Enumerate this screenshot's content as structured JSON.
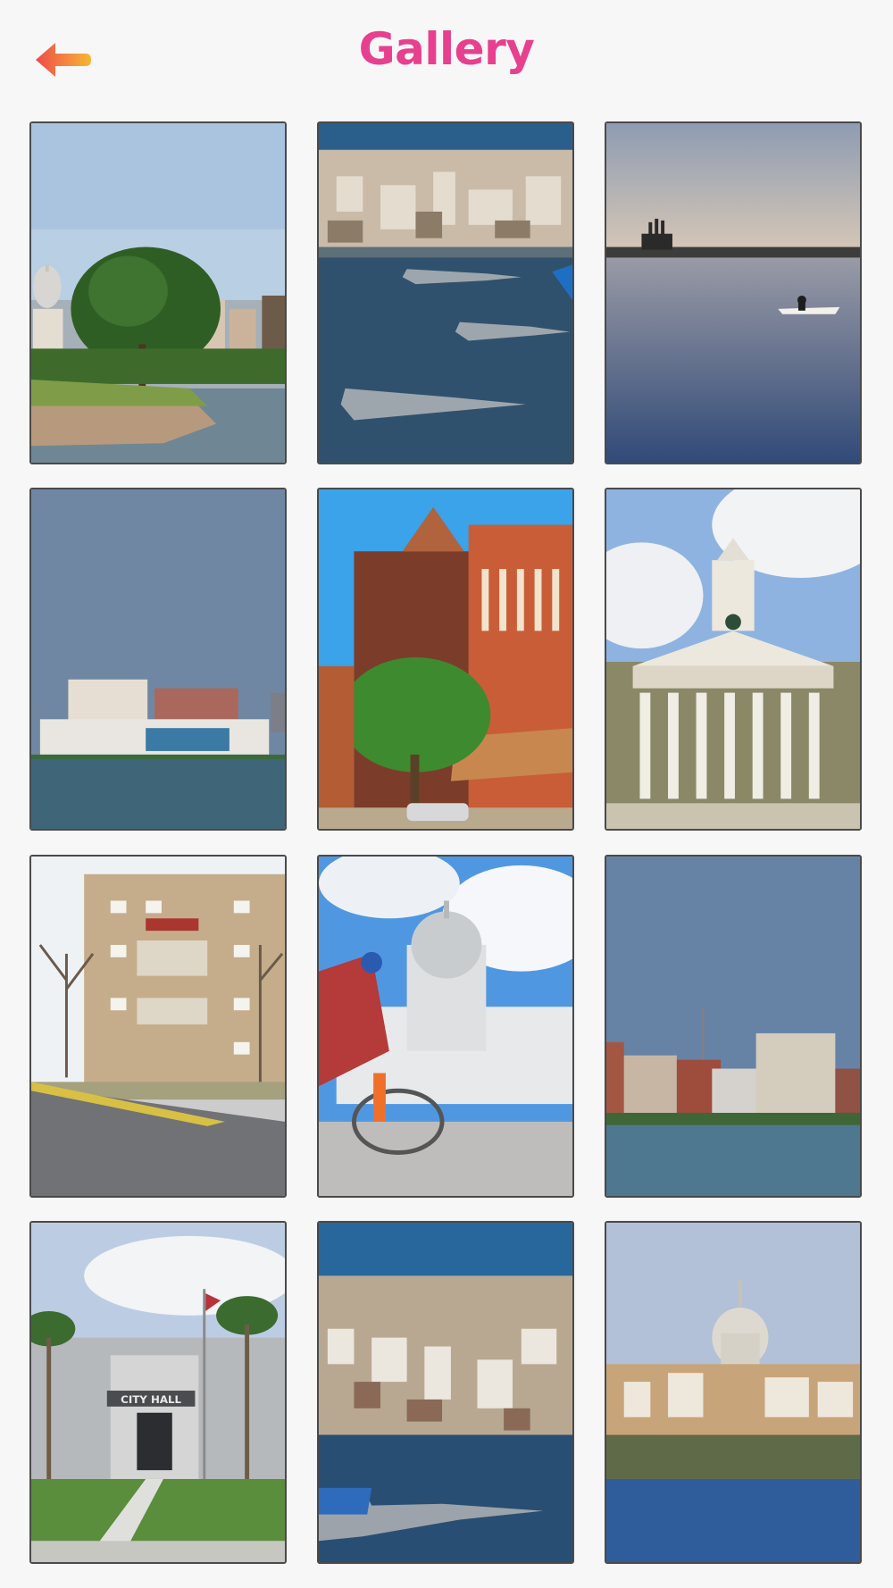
{
  "header": {
    "title": "Gallery",
    "back_icon": "arrow-left-icon"
  },
  "colors": {
    "accent": "#e7408f",
    "back_arrow_start": "#f7b733",
    "back_arrow_end": "#ee4b4b",
    "background": "#f7f7f8",
    "tile_border": "#4a4a4a"
  },
  "gallery": {
    "photos": [
      "lakeshore-capitol-tree",
      "jets-over-city",
      "rower-on-lake",
      "lakefront-convention-center",
      "red-brick-buildings",
      "clock-tower-hall",
      "brick-apartment-building",
      "cyclist-capitol",
      "city-skyline-lake",
      "city-hall",
      "aerial-city-jet",
      "capitol-over-lake"
    ],
    "city_hall_sign": "CITY HALL"
  }
}
